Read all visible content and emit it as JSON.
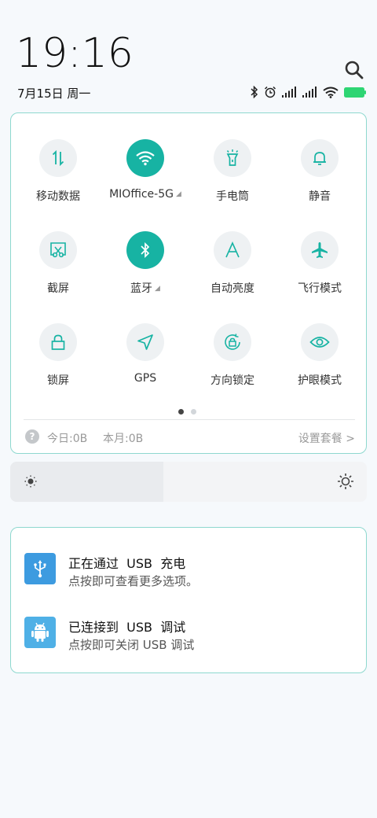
{
  "status_bar": {
    "time": "19:16",
    "date": "7月15日 周一",
    "icons": [
      "bluetooth-icon",
      "alarm-icon",
      "signal-icon",
      "signal-icon",
      "wifi-icon",
      "battery-icon"
    ],
    "battery_color": "#2ed573"
  },
  "quick_settings": {
    "accent": "#17b3a3",
    "tiles": [
      {
        "label": "移动数据",
        "icon": "mobile-data-icon",
        "on": false
      },
      {
        "label": "MIOffice-5G",
        "icon": "wifi-icon",
        "on": true,
        "has_submenu": true
      },
      {
        "label": "手电筒",
        "icon": "flashlight-icon",
        "on": false
      },
      {
        "label": "静音",
        "icon": "bell-icon",
        "on": false
      },
      {
        "label": "截屏",
        "icon": "screenshot-icon",
        "on": false
      },
      {
        "label": "蓝牙",
        "icon": "bluetooth-icon",
        "on": true,
        "has_submenu": true
      },
      {
        "label": "自动亮度",
        "icon": "auto-brightness-icon",
        "on": false
      },
      {
        "label": "飞行模式",
        "icon": "airplane-icon",
        "on": false
      },
      {
        "label": "锁屏",
        "icon": "lock-icon",
        "on": false
      },
      {
        "label": "GPS",
        "icon": "location-arrow-icon",
        "on": false
      },
      {
        "label": "方向锁定",
        "icon": "rotation-lock-icon",
        "on": false
      },
      {
        "label": "护眼模式",
        "icon": "eye-icon",
        "on": false
      }
    ],
    "page_count": 2,
    "current_page": 1,
    "data_usage": {
      "help_icon": "?",
      "today": "今日:0B",
      "month": "本月:0B",
      "plan_link": "设置套餐 >"
    }
  },
  "brightness": {
    "level": 0.43
  },
  "notifications": [
    {
      "icon": "usb-icon",
      "icon_color": "#3d9be0",
      "title": "正在通过  USB  充电",
      "subtitle": "点按即可查看更多选项。"
    },
    {
      "icon": "android-icon",
      "icon_color": "#4fb0e6",
      "title": "已连接到  USB  调试",
      "subtitle": "点按即可关闭 USB 调试"
    }
  ]
}
